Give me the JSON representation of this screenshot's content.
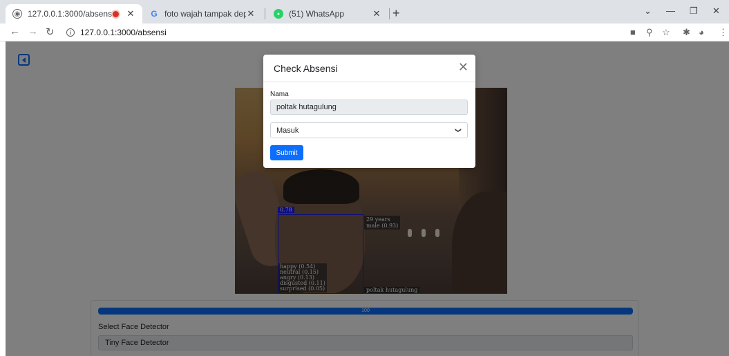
{
  "browser": {
    "tabs": [
      {
        "title": "127.0.0.1:3000/absensi",
        "active": true,
        "recording": true
      },
      {
        "title": "foto wajah tampak depan - Goog",
        "active": false
      },
      {
        "title": "(51) WhatsApp",
        "active": false
      }
    ],
    "url": "127.0.0.1:3000/absensi"
  },
  "page": {
    "video": {
      "detection_score": "0.78",
      "age_gender": [
        "29 years",
        "male (0.93)"
      ],
      "expressions": [
        "happy (0.54)",
        "neutral (0.15)",
        "angry (0.13)",
        "disgusted (0.11)",
        "surprised (0.05)"
      ],
      "matched_name": "poltak hutagulung"
    },
    "progress": {
      "label": "100",
      "value": 100
    },
    "detector": {
      "label": "Select Face Detector",
      "value": "Tiny Face Detector"
    }
  },
  "modal": {
    "title": "Check Absensi",
    "name_label": "Nama",
    "name_value": "poltak hutagulung",
    "status_value": "Masuk",
    "submit_label": "Submit"
  },
  "colors": {
    "accent": "#0d6efd",
    "box": "#1a1aff"
  }
}
